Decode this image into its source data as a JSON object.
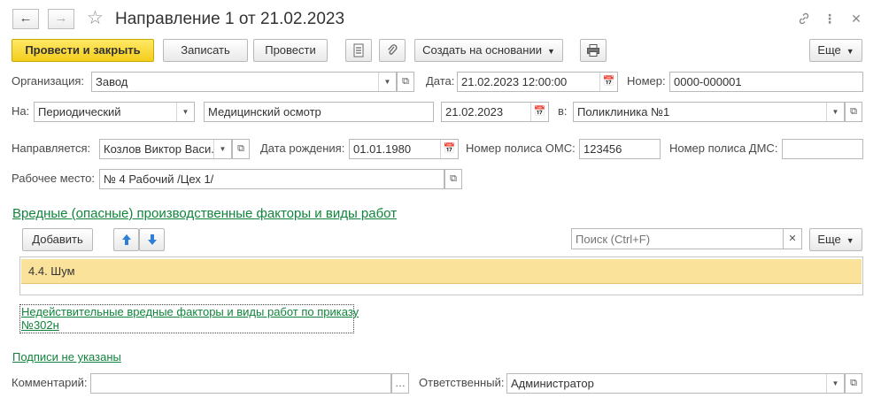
{
  "window": {
    "title": "Направление 1 от 21.02.2023"
  },
  "toolbar": {
    "post_close": "Провести и закрыть",
    "save": "Записать",
    "post": "Провести",
    "create_based": "Создать на основании",
    "more": "Еще"
  },
  "form": {
    "org_label": "Организация:",
    "org_value": "Завод",
    "date_label": "Дата:",
    "date_value": "21.02.2023 12:00:00",
    "number_label": "Номер:",
    "number_value": "0000-000001",
    "to_label": "На:",
    "to_type": "Периодический",
    "to_purpose": "Медицинский осмотр",
    "to_date": "21.02.2023",
    "in_label": "в:",
    "clinic_value": "Поликлиника №1",
    "sent_label": "Направляется:",
    "sent_value": "Козлов Виктор Васи.",
    "birth_label": "Дата рождения:",
    "birth_value": "01.01.1980",
    "oms_label": "Номер полиса ОМС:",
    "oms_value": "123456",
    "dms_label": "Номер полиса ДМС:",
    "dms_value": "",
    "workplace_label": "Рабочее место:",
    "workplace_value": "№ 4 Рабочий /Цех 1/"
  },
  "factors": {
    "title": "Вредные (опасные) производственные факторы и виды работ",
    "add": "Добавить",
    "search_placeholder": "Поиск (Ctrl+F)",
    "more": "Еще",
    "rows": [
      {
        "text": "4.4. Шум"
      }
    ],
    "invalid_link_line1": "Недействительные вредные факторы и виды работ по приказу",
    "invalid_link_line2": "№302н"
  },
  "footer": {
    "signatures_link": "Подписи не указаны",
    "comment_label": "Комментарий:",
    "comment_value": "",
    "responsible_label": "Ответственный:",
    "responsible_value": "Администратор"
  }
}
